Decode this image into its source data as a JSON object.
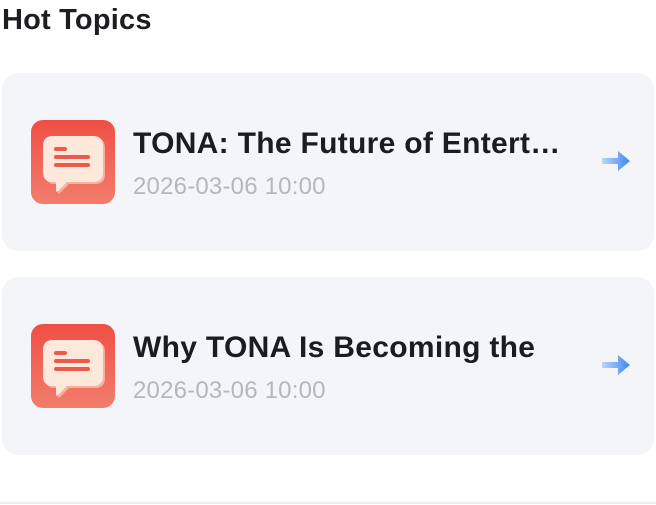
{
  "section": {
    "title": "Hot Topics"
  },
  "topics": [
    {
      "title": "TONA: The Future of Entertainment",
      "time": "2026-03-06 10:00",
      "icon": "chat-bubble-icon",
      "action_icon": "arrow-right-icon"
    },
    {
      "title": "Why TONA Is Becoming the",
      "time": "2026-03-06 10:00",
      "icon": "chat-bubble-icon",
      "action_icon": "arrow-right-icon"
    }
  ],
  "colors": {
    "card_background": "#f4f5f9",
    "icon_gradient_top": "#ef4f45",
    "icon_gradient_bottom": "#f27d6c",
    "arrow": "#3d86f2",
    "title_text": "#1b1c21",
    "time_text": "#b4b7c0"
  }
}
